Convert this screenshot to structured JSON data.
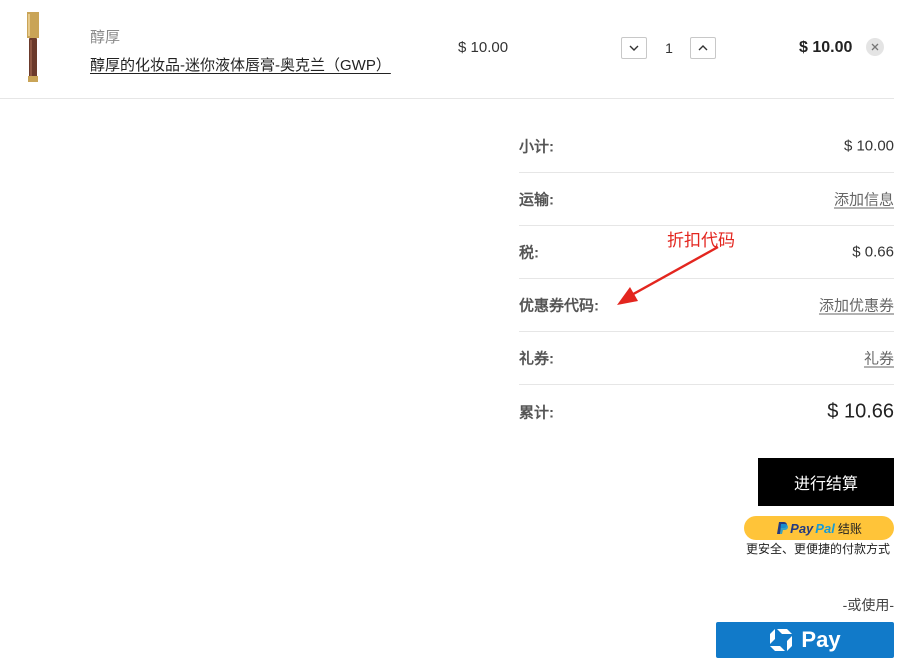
{
  "cart_item": {
    "brand": "醇厚",
    "product_name": "醇厚的化妆品-迷你液体唇膏-奥克兰（GWP）",
    "unit_price": "$ 10.00",
    "quantity": "1",
    "line_total": "$ 10.00"
  },
  "summary": {
    "subtotal_label": "小计:",
    "subtotal_value": "$ 10.00",
    "shipping_label": "运输:",
    "shipping_link": "添加信息",
    "tax_label": "税:",
    "tax_value": "$ 0.66",
    "coupon_label": "优惠券代码:",
    "coupon_link": "添加优惠券",
    "gift_label": "礼券:",
    "gift_link": "礼券",
    "total_label": "累计:",
    "total_value": "$ 10.66"
  },
  "annotation": {
    "text": "折扣代码",
    "color": "#e3261f"
  },
  "checkout": {
    "button_label": "进行结算",
    "paypal_part1": "Pay",
    "paypal_part2": "Pal",
    "paypal_suffix": "结账",
    "paypal_tagline": "更安全、更便捷的付款方式",
    "or_use": "-或使用-",
    "chase_pay_label": "Pay"
  },
  "colors": {
    "paypal_yellow": "#ffc439",
    "chase_blue": "#117ac9"
  }
}
